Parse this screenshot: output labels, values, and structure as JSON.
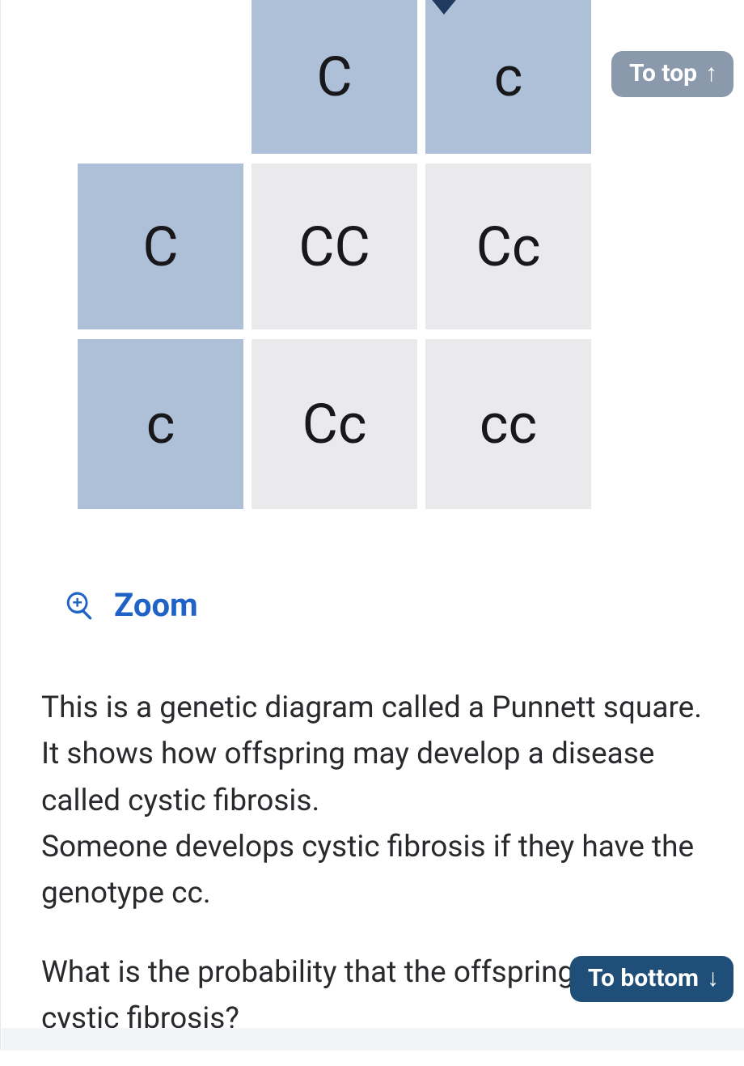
{
  "punnett": {
    "top": [
      "C",
      "c"
    ],
    "left": [
      "C",
      "c"
    ],
    "cells": [
      [
        "CC",
        "Cc"
      ],
      [
        "Cc",
        "cc"
      ]
    ]
  },
  "zoom": {
    "label": "Zoom"
  },
  "text": {
    "p1": "This is a genetic diagram called a Punnett square. It shows how offspring may develop a disease called cystic fibrosis.",
    "p1b": "Someone develops cystic fibrosis if they have the genotype cc.",
    "p2": "What is the probability that the offspring develops cystic fibrosis?"
  },
  "nav": {
    "to_top": "To top",
    "to_bottom": "To bottom"
  }
}
